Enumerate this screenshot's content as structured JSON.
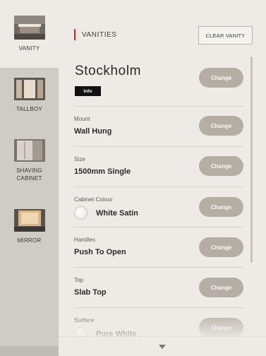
{
  "sidebar": {
    "items": [
      {
        "label": "VANITY",
        "icon": "vanity-thumbnail-icon"
      },
      {
        "label": "TALLBOY",
        "icon": "tallboy-thumbnail-icon"
      },
      {
        "label": "SHAVING CABINET",
        "icon": "shaving-cabinet-thumbnail-icon"
      },
      {
        "label": "MIRROR",
        "icon": "mirror-thumbnail-icon"
      }
    ],
    "active": "VANITY"
  },
  "header": {
    "title": "VANITIES",
    "clear_label": "CLEAR VANITY",
    "accent_color": "#d8262f"
  },
  "product": {
    "name": "Stockholm",
    "info_label": "Info",
    "change_label": "Change"
  },
  "options": [
    {
      "label": "Mount",
      "value": "Wall Hung",
      "change_label": "Change"
    },
    {
      "label": "Size",
      "value": "1500mm Single",
      "change_label": "Change"
    },
    {
      "label": "Cabinet Colour",
      "value": "White Satin",
      "change_label": "Change",
      "swatch": "#f6eef1"
    },
    {
      "label": "Handles",
      "value": "Push To Open",
      "change_label": "Change"
    },
    {
      "label": "Top",
      "value": "Slab Top",
      "change_label": "Change"
    },
    {
      "label": "Surface",
      "value": "Pure White",
      "change_label": "Change",
      "swatch": "#f4f2f3"
    }
  ],
  "colors": {
    "change_button": "#b5aea5",
    "sidebar_bg": "#cfcbc5",
    "panel_bg": "#eeebe7"
  },
  "footer": {
    "icon": "chevron-down-icon"
  }
}
